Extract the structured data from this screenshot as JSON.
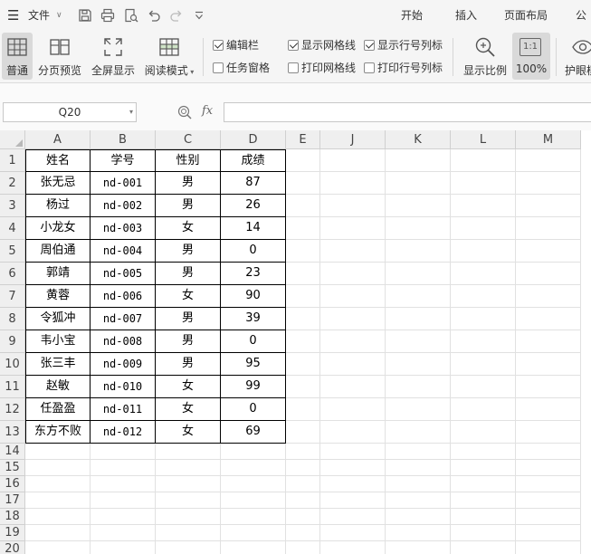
{
  "menubar": {
    "file_label": "文件",
    "tabs": [
      "开始",
      "插入",
      "页面布局",
      "公式"
    ]
  },
  "ribbon": {
    "view_buttons": [
      "普通",
      "分页预览",
      "全屏显示",
      "阅读模式"
    ],
    "checkboxes": [
      {
        "label": "编辑栏",
        "checked": true
      },
      {
        "label": "任务窗格",
        "checked": false
      },
      {
        "label": "显示网格线",
        "checked": true
      },
      {
        "label": "打印网格线",
        "checked": false
      },
      {
        "label": "显示行号列标",
        "checked": true
      },
      {
        "label": "打印行号列标",
        "checked": false
      }
    ],
    "zoom_buttons": [
      "显示比例",
      "100%"
    ],
    "zoom_icon_text": "1:1",
    "last_button": "护眼模"
  },
  "formula_bar": {
    "name_box": "Q20",
    "fx_label": "fx",
    "formula_value": ""
  },
  "sheet": {
    "columns": [
      "A",
      "B",
      "C",
      "D",
      "E",
      "J",
      "K",
      "L",
      "M"
    ],
    "rows": [
      "1",
      "2",
      "3",
      "4",
      "5",
      "6",
      "7",
      "8",
      "9",
      "10",
      "11",
      "12",
      "13",
      "14",
      "15",
      "16",
      "17",
      "18",
      "19",
      "20"
    ],
    "table": [
      [
        "姓名",
        "学号",
        "性别",
        "成绩"
      ],
      [
        "张无忌",
        "nd-001",
        "男",
        "87"
      ],
      [
        "杨过",
        "nd-002",
        "男",
        "26"
      ],
      [
        "小龙女",
        "nd-003",
        "女",
        "14"
      ],
      [
        "周伯通",
        "nd-004",
        "男",
        "0"
      ],
      [
        "郭靖",
        "nd-005",
        "男",
        "23"
      ],
      [
        "黄蓉",
        "nd-006",
        "女",
        "90"
      ],
      [
        "令狐冲",
        "nd-007",
        "男",
        "39"
      ],
      [
        "韦小宝",
        "nd-008",
        "男",
        "0"
      ],
      [
        "张三丰",
        "nd-009",
        "男",
        "95"
      ],
      [
        "赵敏",
        "nd-010",
        "女",
        "99"
      ],
      [
        "任盈盈",
        "nd-011",
        "女",
        "0"
      ],
      [
        "东方不败",
        "nd-012",
        "女",
        "69"
      ]
    ]
  }
}
